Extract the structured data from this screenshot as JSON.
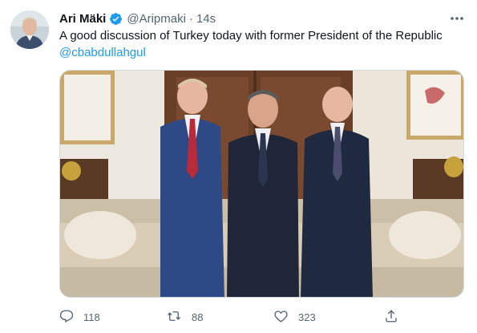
{
  "tweet": {
    "author": {
      "display_name": "Ari Mäki",
      "handle": "@Aripmaki",
      "verified": true
    },
    "separator": "·",
    "time": "14s",
    "text": "A good discussion of Turkey today with former President of the Republic",
    "mention": "@cbabdullahgul",
    "stats": {
      "replies": "118",
      "retweets": "88",
      "likes": "323"
    }
  },
  "icons": {
    "more": "more-icon",
    "verified": "verified-badge-icon",
    "reply": "reply-icon",
    "retweet": "retweet-icon",
    "like": "heart-icon",
    "share": "share-icon"
  },
  "colors": {
    "accent": "#1d9bf0",
    "secondary_text": "#536471",
    "primary_text": "#0f1419"
  }
}
